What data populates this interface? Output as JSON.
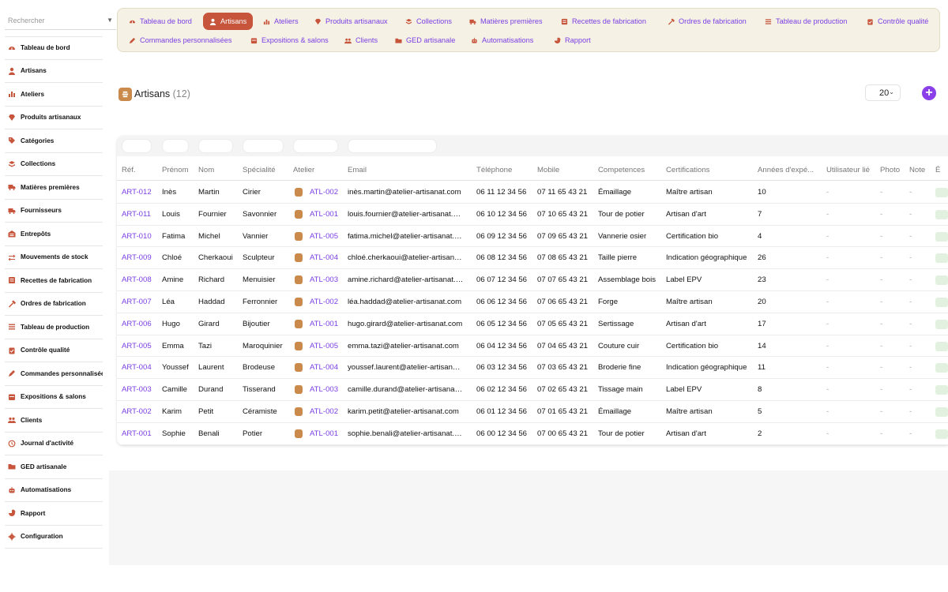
{
  "search": {
    "placeholder": "Rechercher"
  },
  "sidebar": {
    "items": [
      {
        "label": "Tableau de bord",
        "icon": "dashboard-icon"
      },
      {
        "label": "Artisans",
        "icon": "person-icon"
      },
      {
        "label": "Ateliers",
        "icon": "chart-icon"
      },
      {
        "label": "Produits artisanaux",
        "icon": "gem-icon"
      },
      {
        "label": "Catégories",
        "icon": "tag-icon"
      },
      {
        "label": "Collections",
        "icon": "layers-icon"
      },
      {
        "label": "Matières premières",
        "icon": "truck-icon"
      },
      {
        "label": "Fournisseurs",
        "icon": "truck-icon"
      },
      {
        "label": "Entrepôts",
        "icon": "warehouse-icon"
      },
      {
        "label": "Mouvements de stock",
        "icon": "exchange-icon"
      },
      {
        "label": "Recettes de fabrication",
        "icon": "recipe-icon"
      },
      {
        "label": "Ordres de fabrication",
        "icon": "hammer-icon"
      },
      {
        "label": "Tableau de production",
        "icon": "list-icon"
      },
      {
        "label": "Contrôle qualité",
        "icon": "clipboard-check-icon"
      },
      {
        "label": "Commandes personnalisées",
        "icon": "pencil-icon"
      },
      {
        "label": "Expositions & salons",
        "icon": "calendar-icon"
      },
      {
        "label": "Clients",
        "icon": "users-icon"
      },
      {
        "label": "Journal d'activité",
        "icon": "history-icon"
      },
      {
        "label": "GED artisanale",
        "icon": "folder-icon"
      },
      {
        "label": "Automatisations",
        "icon": "robot-icon"
      },
      {
        "label": "Rapport",
        "icon": "pie-chart-icon"
      },
      {
        "label": "Configuration",
        "icon": "gear-icon"
      }
    ]
  },
  "tabs": [
    {
      "label": "Tableau de bord",
      "icon": "dashboard-icon",
      "active": false
    },
    {
      "label": "Artisans",
      "icon": "person-icon",
      "active": true
    },
    {
      "label": "Ateliers",
      "icon": "chart-icon",
      "active": false
    },
    {
      "label": "Produits artisanaux",
      "icon": "gem-icon",
      "active": false
    },
    {
      "label": "Collections",
      "icon": "layers-icon",
      "active": false
    },
    {
      "label": "Matières premières",
      "icon": "truck-icon",
      "active": false
    },
    {
      "label": "Recettes de fabrication",
      "icon": "recipe-icon",
      "active": false
    },
    {
      "label": "Ordres de fabrication",
      "icon": "hammer-icon",
      "active": false
    },
    {
      "label": "Tableau de production",
      "icon": "list-icon",
      "active": false
    },
    {
      "label": "Contrôle qualité",
      "icon": "clipboard-check-icon",
      "active": false
    },
    {
      "label": "Commandes personnalisées",
      "icon": "pencil-icon",
      "active": false
    },
    {
      "label": "Expositions & salons",
      "icon": "calendar-icon",
      "active": false
    },
    {
      "label": "Clients",
      "icon": "users-icon",
      "active": false
    },
    {
      "label": "GED artisanale",
      "icon": "folder-icon",
      "active": false
    },
    {
      "label": "Automatisations",
      "icon": "robot-icon",
      "active": false
    },
    {
      "label": "Rapport",
      "icon": "pie-chart-icon",
      "active": false
    }
  ],
  "page": {
    "title": "Artisans",
    "count": "(12)",
    "per_page": "20",
    "add_label": "+"
  },
  "colors": {
    "accent": "#7b3fe4",
    "active_tab": "#c7553c",
    "tabs_bg": "#f5f1e4",
    "icon_brown": "#c98a4b",
    "sidebar_icon": "#c7553c"
  },
  "table": {
    "columns": [
      "Réf.",
      "Prénom",
      "Nom",
      "Spécialité",
      "Atelier",
      "Email",
      "Téléphone",
      "Mobile",
      "Competences",
      "Certifications",
      "Années d'expé...",
      "Utilisateur lié",
      "Photo",
      "Note",
      "É"
    ],
    "rows": [
      [
        "ART-012",
        "Inès",
        "Martin",
        "Cirier",
        "ATL-002",
        "inès.martin@atelier-artisanat.com",
        "06 11 12 34 56",
        "07 11 65 43 21",
        "Émaillage",
        "Maître artisan",
        "10",
        "-",
        "-",
        "-"
      ],
      [
        "ART-011",
        "Louis",
        "Fournier",
        "Savonnier",
        "ATL-001",
        "louis.fournier@atelier-artisanat.…",
        "06 10 12 34 56",
        "07 10 65 43 21",
        "Tour de potier",
        "Artisan d'art",
        "7",
        "-",
        "-",
        "-"
      ],
      [
        "ART-010",
        "Fatima",
        "Michel",
        "Vannier",
        "ATL-005",
        "fatima.michel@atelier-artisanat.…",
        "06 09 12 34 56",
        "07 09 65 43 21",
        "Vannerie osier",
        "Certification bio",
        "4",
        "-",
        "-",
        "-"
      ],
      [
        "ART-009",
        "Chloé",
        "Cherkaoui",
        "Sculpteur",
        "ATL-004",
        "chloé.cherkaoui@atelier-artisan…",
        "06 08 12 34 56",
        "07 08 65 43 21",
        "Taille pierre",
        "Indication géographique",
        "26",
        "-",
        "-",
        "-"
      ],
      [
        "ART-008",
        "Amine",
        "Richard",
        "Menuisier",
        "ATL-003",
        "amine.richard@atelier-artisanat.…",
        "06 07 12 34 56",
        "07 07 65 43 21",
        "Assemblage bois",
        "Label EPV",
        "23",
        "-",
        "-",
        "-"
      ],
      [
        "ART-007",
        "Léa",
        "Haddad",
        "Ferronnier",
        "ATL-002",
        "léa.haddad@atelier-artisanat.com",
        "06 06 12 34 56",
        "07 06 65 43 21",
        "Forge",
        "Maître artisan",
        "20",
        "-",
        "-",
        "-"
      ],
      [
        "ART-006",
        "Hugo",
        "Girard",
        "Bijoutier",
        "ATL-001",
        "hugo.girard@atelier-artisanat.com",
        "06 05 12 34 56",
        "07 05 65 43 21",
        "Sertissage",
        "Artisan d'art",
        "17",
        "-",
        "-",
        "-"
      ],
      [
        "ART-005",
        "Emma",
        "Tazi",
        "Maroquinier",
        "ATL-005",
        "emma.tazi@atelier-artisanat.com",
        "06 04 12 34 56",
        "07 04 65 43 21",
        "Couture cuir",
        "Certification bio",
        "14",
        "-",
        "-",
        "-"
      ],
      [
        "ART-004",
        "Youssef",
        "Laurent",
        "Brodeuse",
        "ATL-004",
        "youssef.laurent@atelier-artisan…",
        "06 03 12 34 56",
        "07 03 65 43 21",
        "Broderie fine",
        "Indication géographique",
        "11",
        "-",
        "-",
        "-"
      ],
      [
        "ART-003",
        "Camille",
        "Durand",
        "Tisserand",
        "ATL-003",
        "camille.durand@atelier-artisana…",
        "06 02 12 34 56",
        "07 02 65 43 21",
        "Tissage main",
        "Label EPV",
        "8",
        "-",
        "-",
        "-"
      ],
      [
        "ART-002",
        "Karim",
        "Petit",
        "Céramiste",
        "ATL-002",
        "karim.petit@atelier-artisanat.com",
        "06 01 12 34 56",
        "07 01 65 43 21",
        "Émaillage",
        "Maître artisan",
        "5",
        "-",
        "-",
        "-"
      ],
      [
        "ART-001",
        "Sophie",
        "Benali",
        "Potier",
        "ATL-001",
        "sophie.benali@atelier-artisanat.…",
        "06 00 12 34 56",
        "07 00 65 43 21",
        "Tour de potier",
        "Artisan d'art",
        "2",
        "-",
        "-",
        "-"
      ]
    ]
  }
}
